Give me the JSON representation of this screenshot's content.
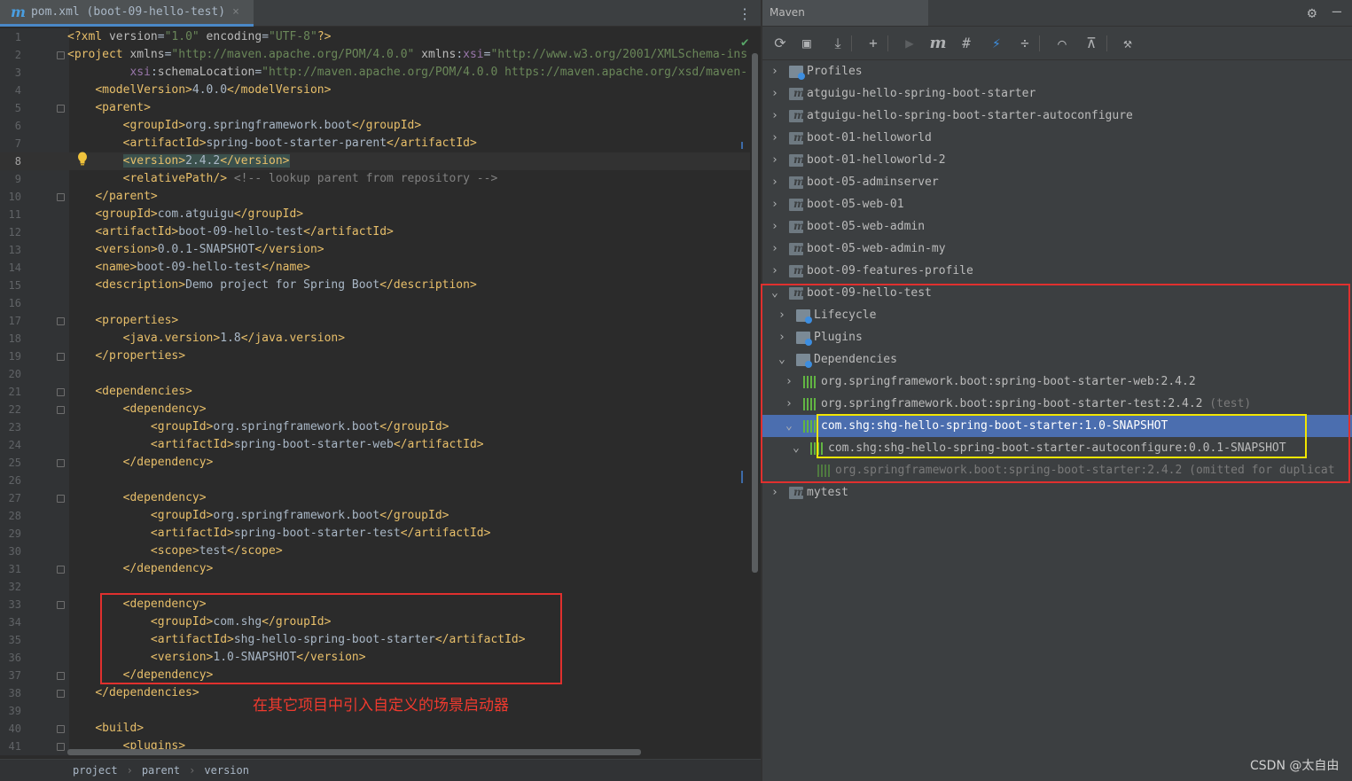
{
  "editor": {
    "tab": {
      "icon": "maven-m-icon",
      "label": "pom.xml (boot-09-hello-test)",
      "close": "×"
    },
    "menu_icon": "⋮",
    "current_line": 8,
    "lines": [
      {
        "n": "1",
        "html": "<span class=\"tag\">&lt;?xml </span><span class=\"atn\">version</span><span class=\"txt\">=</span><span class=\"atv\">\"1.0\"</span><span class=\"atn\"> encoding</span><span class=\"txt\">=</span><span class=\"atv\">\"UTF-8\"</span><span class=\"tag\">?&gt;</span>"
      },
      {
        "n": "2",
        "html": "<span class=\"tag\">&lt;project </span><span class=\"atn\">xmlns</span><span class=\"txt\">=</span><span class=\"atv\">\"http://maven.apache.org/POM/4.0.0\"</span><span class=\"atn\"> xmlns</span><span class=\"txt\">:</span><span class=\"ns\">xsi</span><span class=\"txt\">=</span><span class=\"atv\">\"http://www.w3.org/2001/XMLSchema-ins</span>"
      },
      {
        "n": "3",
        "html": "         <span class=\"ns\">xsi</span><span class=\"txt\">:</span><span class=\"atn\">schemaLocation</span><span class=\"txt\">=</span><span class=\"atv\">\"http://maven.apache.org/POM/4.0.0 https://maven.apache.org/xsd/maven-</span>"
      },
      {
        "n": "4",
        "html": "    <span class=\"tag\">&lt;modelVersion&gt;</span><span class=\"txt\">4.0.0</span><span class=\"tag\">&lt;/modelVersion&gt;</span>"
      },
      {
        "n": "5",
        "html": "    <span class=\"tag\">&lt;parent&gt;</span>"
      },
      {
        "n": "6",
        "html": "        <span class=\"tag\">&lt;groupId&gt;</span><span class=\"txt\">org.springframework.boot</span><span class=\"tag\">&lt;/groupId&gt;</span>"
      },
      {
        "n": "7",
        "html": "        <span class=\"tag\">&lt;artifactId&gt;</span><span class=\"txt\">spring-boot-starter-parent</span><span class=\"tag\">&lt;/artifactId&gt;</span>"
      },
      {
        "n": "8",
        "html": "        <span class=\"hl\"><span class=\"tag\">&lt;version&gt;</span><span class=\"txt\">2.4.2</span><span class=\"tag\">&lt;/version&gt;</span></span>"
      },
      {
        "n": "9",
        "html": "        <span class=\"tag\">&lt;relativePath/&gt;</span> <span class=\"cmt\">&lt;!-- lookup parent from repository --&gt;</span>"
      },
      {
        "n": "10",
        "html": "    <span class=\"tag\">&lt;/parent&gt;</span>"
      },
      {
        "n": "11",
        "html": "    <span class=\"tag\">&lt;groupId&gt;</span><span class=\"txt\">com.atguigu</span><span class=\"tag\">&lt;/groupId&gt;</span>"
      },
      {
        "n": "12",
        "html": "    <span class=\"tag\">&lt;artifactId&gt;</span><span class=\"txt\">boot-09-hello-test</span><span class=\"tag\">&lt;/artifactId&gt;</span>"
      },
      {
        "n": "13",
        "html": "    <span class=\"tag\">&lt;version&gt;</span><span class=\"txt\">0.0.1-SNAPSHOT</span><span class=\"tag\">&lt;/version&gt;</span>"
      },
      {
        "n": "14",
        "html": "    <span class=\"tag\">&lt;name&gt;</span><span class=\"txt\">boot-09-hello-test</span><span class=\"tag\">&lt;/name&gt;</span>"
      },
      {
        "n": "15",
        "html": "    <span class=\"tag\">&lt;description&gt;</span><span class=\"txt\">Demo project for Spring Boot</span><span class=\"tag\">&lt;/description&gt;</span>"
      },
      {
        "n": "16",
        "html": ""
      },
      {
        "n": "17",
        "html": "    <span class=\"tag\">&lt;properties&gt;</span>"
      },
      {
        "n": "18",
        "html": "        <span class=\"tag\">&lt;java.version&gt;</span><span class=\"txt\">1.8</span><span class=\"tag\">&lt;/java.version&gt;</span>"
      },
      {
        "n": "19",
        "html": "    <span class=\"tag\">&lt;/properties&gt;</span>"
      },
      {
        "n": "20",
        "html": ""
      },
      {
        "n": "21",
        "html": "    <span class=\"tag\">&lt;dependencies&gt;</span>"
      },
      {
        "n": "22",
        "html": "        <span class=\"tag\">&lt;dependency&gt;</span>"
      },
      {
        "n": "23",
        "html": "            <span class=\"tag\">&lt;groupId&gt;</span><span class=\"txt\">org.springframework.boot</span><span class=\"tag\">&lt;/groupId&gt;</span>"
      },
      {
        "n": "24",
        "html": "            <span class=\"tag\">&lt;artifactId&gt;</span><span class=\"txt\">spring-boot-starter-web</span><span class=\"tag\">&lt;/artifactId&gt;</span>"
      },
      {
        "n": "25",
        "html": "        <span class=\"tag\">&lt;/dependency&gt;</span>"
      },
      {
        "n": "26",
        "html": ""
      },
      {
        "n": "27",
        "html": "        <span class=\"tag\">&lt;dependency&gt;</span>"
      },
      {
        "n": "28",
        "html": "            <span class=\"tag\">&lt;groupId&gt;</span><span class=\"txt\">org.springframework.boot</span><span class=\"tag\">&lt;/groupId&gt;</span>"
      },
      {
        "n": "29",
        "html": "            <span class=\"tag\">&lt;artifactId&gt;</span><span class=\"txt\">spring-boot-starter-test</span><span class=\"tag\">&lt;/artifactId&gt;</span>"
      },
      {
        "n": "30",
        "html": "            <span class=\"tag\">&lt;scope&gt;</span><span class=\"txt\">test</span><span class=\"tag\">&lt;/scope&gt;</span>"
      },
      {
        "n": "31",
        "html": "        <span class=\"tag\">&lt;/dependency&gt;</span>"
      },
      {
        "n": "32",
        "html": ""
      },
      {
        "n": "33",
        "html": "        <span class=\"tag\">&lt;dependency&gt;</span>"
      },
      {
        "n": "34",
        "html": "            <span class=\"tag\">&lt;groupId&gt;</span><span class=\"txt\">com.shg</span><span class=\"tag\">&lt;/groupId&gt;</span>"
      },
      {
        "n": "35",
        "html": "            <span class=\"tag\">&lt;artifactId&gt;</span><span class=\"txt\">shg-hello-spring-boot-starter</span><span class=\"tag\">&lt;/artifactId&gt;</span>"
      },
      {
        "n": "36",
        "html": "            <span class=\"tag\">&lt;version&gt;</span><span class=\"txt\">1.0-SNAPSHOT</span><span class=\"tag\">&lt;/version&gt;</span>"
      },
      {
        "n": "37",
        "html": "        <span class=\"tag\">&lt;/dependency&gt;</span>"
      },
      {
        "n": "38",
        "html": "    <span class=\"tag\">&lt;/dependencies&gt;</span>"
      },
      {
        "n": "39",
        "html": ""
      },
      {
        "n": "40",
        "html": "    <span class=\"tag\">&lt;build&gt;</span>"
      },
      {
        "n": "41",
        "html": "        <span class=\"tag\">&lt;plugins&gt;</span>"
      }
    ],
    "fold_lines": [
      2,
      5,
      10,
      17,
      19,
      21,
      22,
      25,
      27,
      31,
      33,
      37,
      38,
      40,
      41
    ],
    "annotation": "在其它项目中引入自定义的场景启动器",
    "breadcrumb": [
      "project",
      "parent",
      "version"
    ]
  },
  "maven": {
    "title": "Maven",
    "toolbar": [
      {
        "icon": "refresh-icon",
        "glyph": "⟳",
        "disabled": false
      },
      {
        "icon": "generate-sources-icon",
        "glyph": "▣",
        "disabled": false
      },
      {
        "icon": "download-icon",
        "glyph": "⤓",
        "disabled": false
      },
      {
        "icon": "add-icon",
        "glyph": "+",
        "disabled": false
      },
      {
        "icon": "run-icon",
        "glyph": "▶",
        "disabled": true
      },
      {
        "icon": "execute-goal-icon",
        "glyph": "m",
        "disabled": false
      },
      {
        "icon": "toggle-offline-icon",
        "glyph": "#",
        "disabled": false
      },
      {
        "icon": "skip-tests-icon",
        "glyph": "⚡",
        "disabled": false
      },
      {
        "icon": "collapse-all-icon",
        "glyph": "÷",
        "disabled": false
      },
      {
        "icon": "show-dependencies-icon",
        "glyph": "⌒",
        "disabled": false
      },
      {
        "icon": "expand-icon",
        "glyph": "⊼",
        "disabled": false
      },
      {
        "icon": "settings-wrench-icon",
        "glyph": "⚒",
        "disabled": false
      }
    ],
    "tree": [
      {
        "label": "Profiles",
        "level": 0,
        "arrow": "›",
        "icon": "folder"
      },
      {
        "label": "atguigu-hello-spring-boot-starter",
        "level": 0,
        "arrow": "›",
        "icon": "mod"
      },
      {
        "label": "atguigu-hello-spring-boot-starter-autoconfigure",
        "level": 0,
        "arrow": "›",
        "icon": "mod"
      },
      {
        "label": "boot-01-helloworld",
        "level": 0,
        "arrow": "›",
        "icon": "mod"
      },
      {
        "label": "boot-01-helloworld-2",
        "level": 0,
        "arrow": "›",
        "icon": "mod"
      },
      {
        "label": "boot-05-adminserver",
        "level": 0,
        "arrow": "›",
        "icon": "mod"
      },
      {
        "label": "boot-05-web-01",
        "level": 0,
        "arrow": "›",
        "icon": "mod"
      },
      {
        "label": "boot-05-web-admin",
        "level": 0,
        "arrow": "›",
        "icon": "mod"
      },
      {
        "label": "boot-05-web-admin-my",
        "level": 0,
        "arrow": "›",
        "icon": "mod"
      },
      {
        "label": "boot-09-features-profile",
        "level": 0,
        "arrow": "›",
        "icon": "mod"
      },
      {
        "label": "boot-09-hello-test",
        "level": 0,
        "arrow": "⌄",
        "icon": "mod"
      },
      {
        "label": "Lifecycle",
        "level": 1,
        "arrow": "›",
        "icon": "folder"
      },
      {
        "label": "Plugins",
        "level": 1,
        "arrow": "›",
        "icon": "folder"
      },
      {
        "label": "Dependencies",
        "level": 1,
        "arrow": "⌄",
        "icon": "folder"
      },
      {
        "label": "org.springframework.boot:spring-boot-starter-web:2.4.2",
        "level": 2,
        "arrow": "›",
        "icon": "dep"
      },
      {
        "label": "org.springframework.boot:spring-boot-starter-test:2.4.2",
        "suffix": " (test)",
        "level": 2,
        "arrow": "›",
        "icon": "dep"
      },
      {
        "label": "com.shg:shg-hello-spring-boot-starter:1.0-SNAPSHOT",
        "level": 2,
        "arrow": "⌄",
        "icon": "dep",
        "selected": true
      },
      {
        "label": "com.shg:shg-hello-spring-boot-starter-autoconfigure:0.0.1-SNAPSHOT",
        "level": 3,
        "arrow": "⌄",
        "icon": "dep"
      },
      {
        "label": "org.springframework.boot:spring-boot-starter:2.4.2 (omitted for duplicat",
        "level": 4,
        "arrow": "",
        "icon": "dep-dim",
        "dim": true
      },
      {
        "label": "mytest",
        "level": 0,
        "arrow": "›",
        "icon": "mod"
      }
    ]
  },
  "watermark": "CSDN @太自由"
}
